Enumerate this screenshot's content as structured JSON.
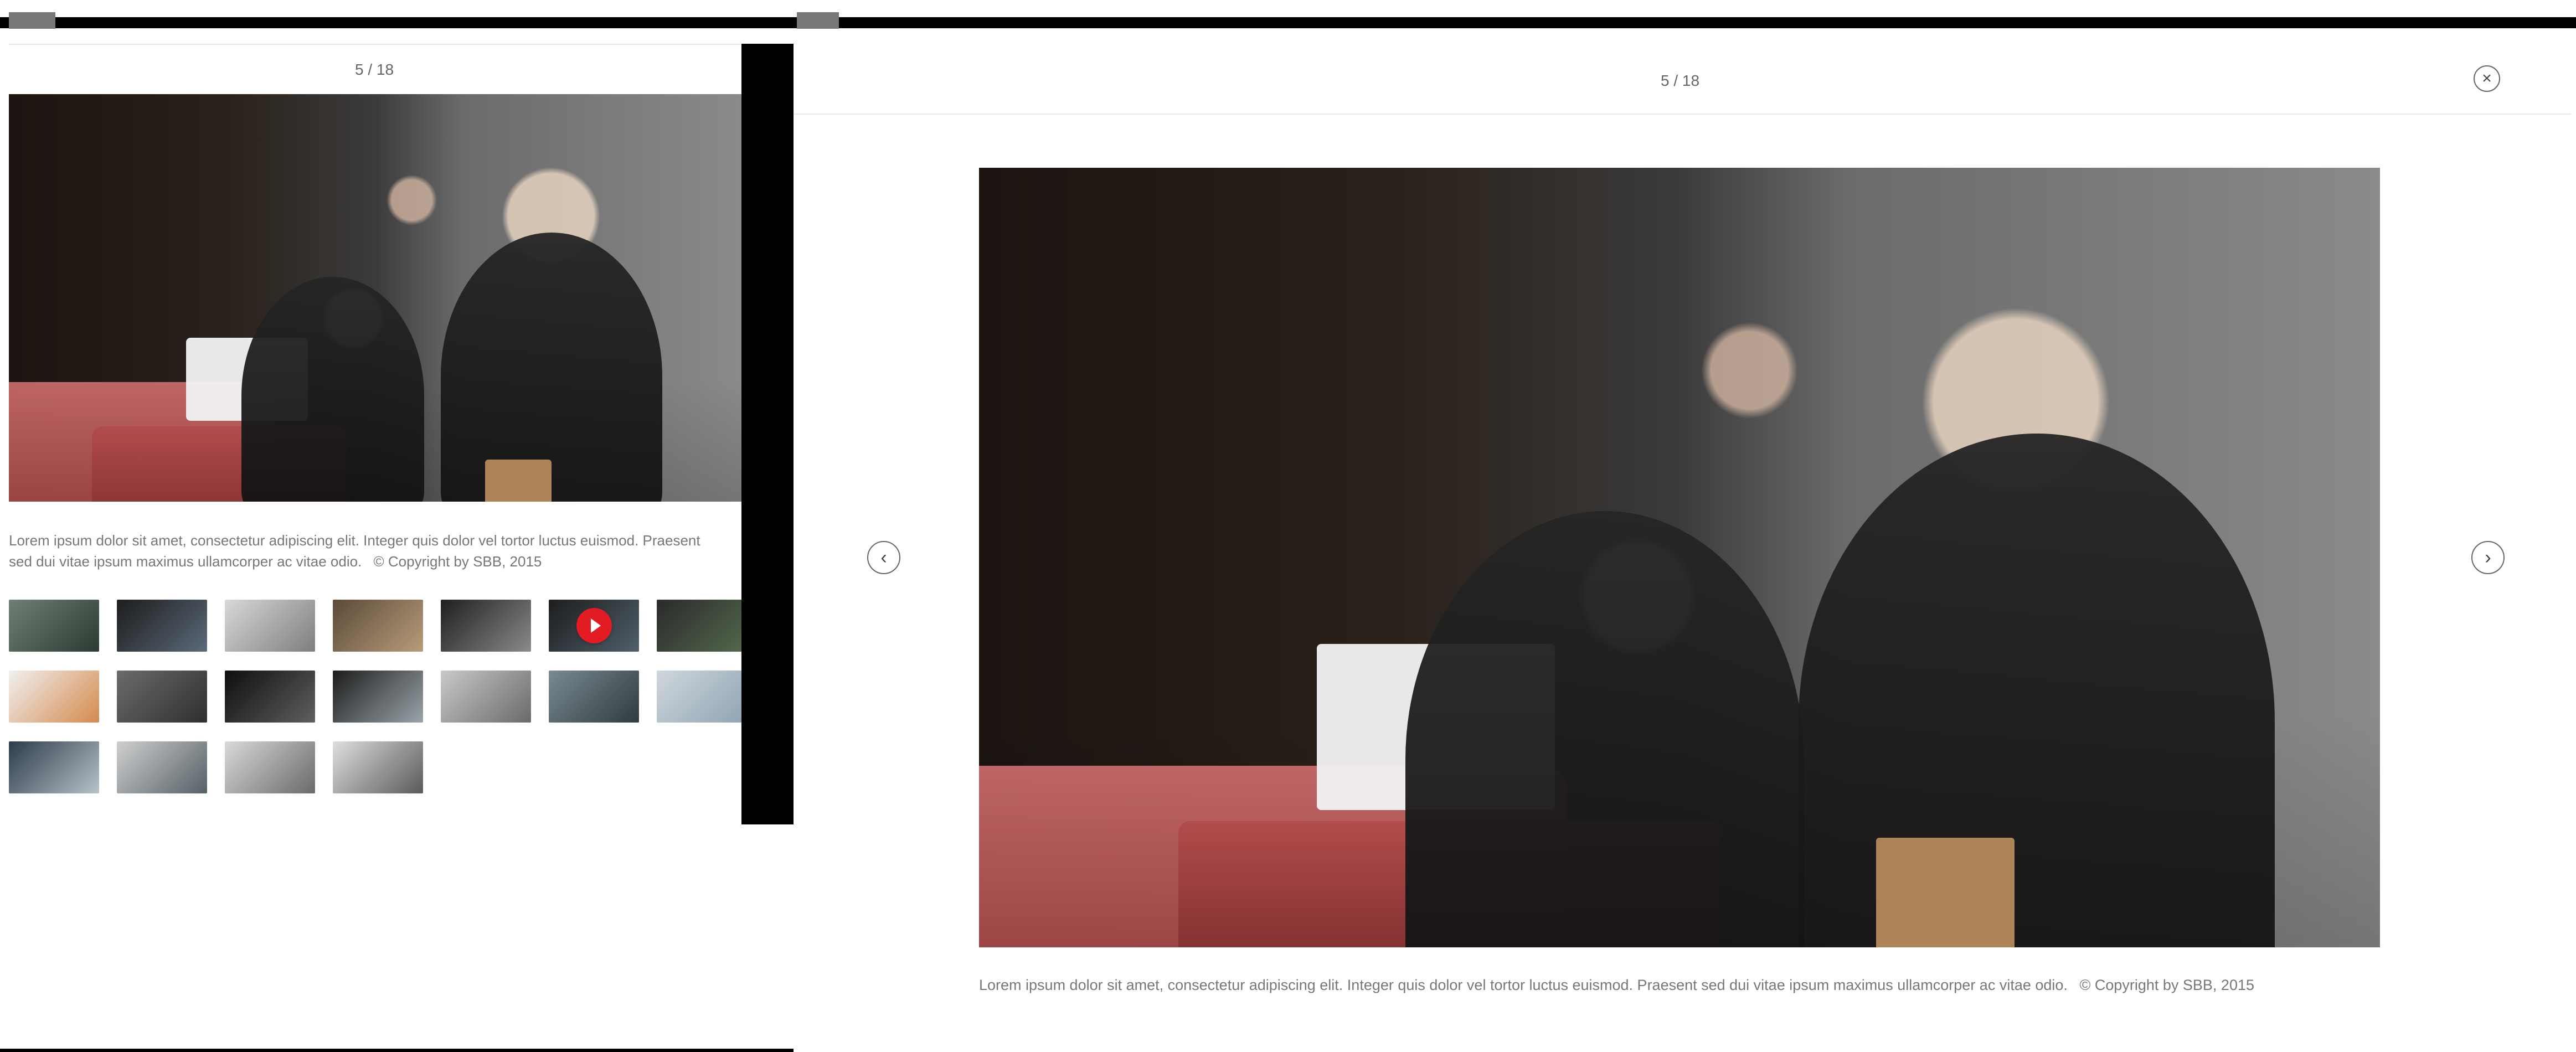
{
  "left_panel": {
    "counter": "5 / 18",
    "caption_line_1": "Lorem ipsum dolor sit amet, consectetur adipiscing elit. Integer quis dolor vel tortor luctus euismod. Praesent",
    "caption_line_2": "sed dui vitae ipsum maximus ullamcorper ac vitae odio.",
    "caption_copyright": "© Copyright by SBB, 2015",
    "thumbnails": {
      "count": 18,
      "active_index": 5,
      "video_index": 6
    }
  },
  "right_panel": {
    "counter": "5 / 18",
    "caption": "Lorem ipsum dolor sit amet, consectetur adipiscing elit. Integer quis dolor vel tortor luctus euismod. Praesent sed dui vitae ipsum maximus ullamcorper ac vitae odio.",
    "caption_copyright": "© Copyright by SBB, 2015",
    "icons": {
      "close": "close-icon",
      "prev": "chevron-left-icon",
      "next": "chevron-right-icon"
    }
  },
  "colors": {
    "accent_red": "#e31b23",
    "divider": "#e9e9e9",
    "text": "#666666"
  }
}
